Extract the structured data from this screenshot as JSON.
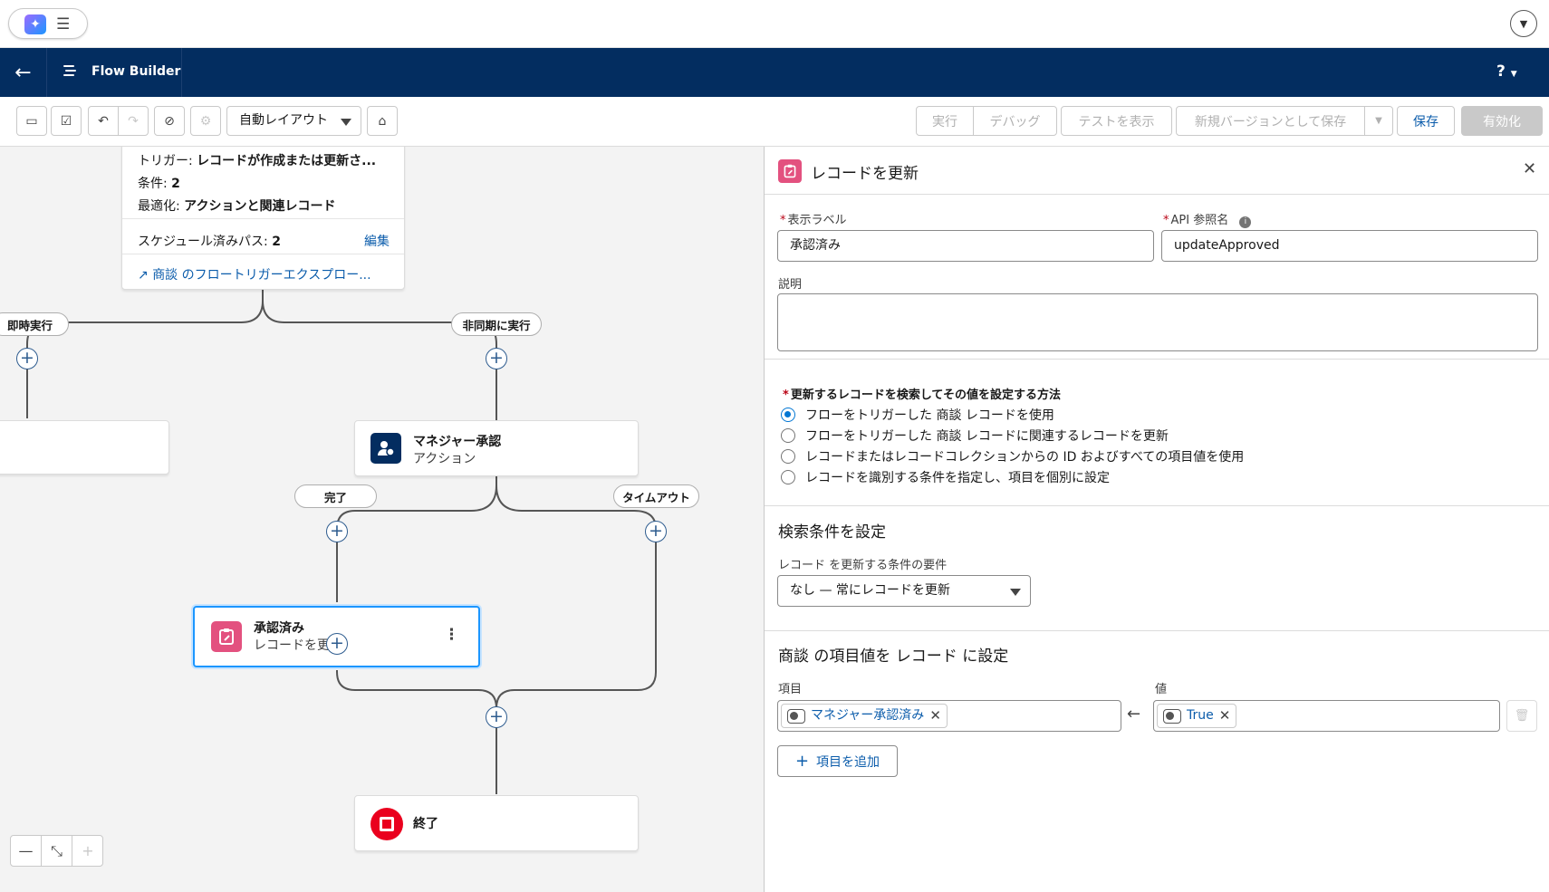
{
  "topbar": {
    "app_launcher_icon": "sparkle-icon",
    "menu_icon": "hamburger-icon",
    "profile_icon": "chevron-down-icon"
  },
  "header": {
    "title": "Flow Builder",
    "help_label": "?",
    "back_icon": "arrow-left-icon",
    "flow_icon": "flow-icon",
    "color": "#032d60"
  },
  "toolbar": {
    "layout_label": "自動レイアウト",
    "run_label": "実行",
    "debug_label": "デバッグ",
    "view_tests_label": "テストを表示",
    "save_as_new_label": "新規バージョンとして保存",
    "save_label": "保存",
    "activate_label": "有効化"
  },
  "canvas": {
    "start_card": {
      "trigger_label": "トリガー:",
      "trigger_value": "レコードが作成または更新さ...",
      "conditions_label": "条件:",
      "conditions_value": "2",
      "optimization_label": "最適化:",
      "optimization_value": "アクションと関連レコード",
      "scheduled_paths_label": "スケジュール済みパス:",
      "scheduled_paths_value": "2",
      "edit_label": "編集",
      "explorer_link": "商談 のフロートリガーエクスプロー..."
    },
    "paths": {
      "immediate": "即時実行",
      "async": "非同期に実行",
      "complete": "完了",
      "timeout": "タイムアウト"
    },
    "nodes": {
      "approval_title": "マネジャー承認",
      "approval_sub": "アクション",
      "update_title": "承認済み",
      "update_sub": "レコードを更新",
      "end_title": "終了"
    }
  },
  "panel": {
    "title": "レコードを更新",
    "label_field_label": "表示ラベル",
    "label_field_value": "承認済み",
    "api_field_label": "API 参照名",
    "api_field_value": "updateApproved",
    "description_label": "説明",
    "description_value": "",
    "method_label": "更新するレコードを検索してその値を設定する方法",
    "method_options": [
      "フローをトリガーした 商談 レコードを使用",
      "フローをトリガーした 商談 レコードに関連するレコードを更新",
      "レコードまたはレコードコレクションからの ID およびすべての項目値を使用",
      "レコードを識別する条件を指定し、項目を個別に設定"
    ],
    "method_selected_index": 0,
    "filter_section_title": "検索条件を設定",
    "filter_req_label": "レコード を更新する条件の要件",
    "filter_req_value": "なし — 常にレコードを更新",
    "set_section_title": "商談 の項目値を レコード に設定",
    "field_col_label": "項目",
    "value_col_label": "値",
    "field_chip": "マネジャー承認済み",
    "value_chip": "True",
    "add_field_label": "項目を追加",
    "accent": "#0176d3"
  }
}
